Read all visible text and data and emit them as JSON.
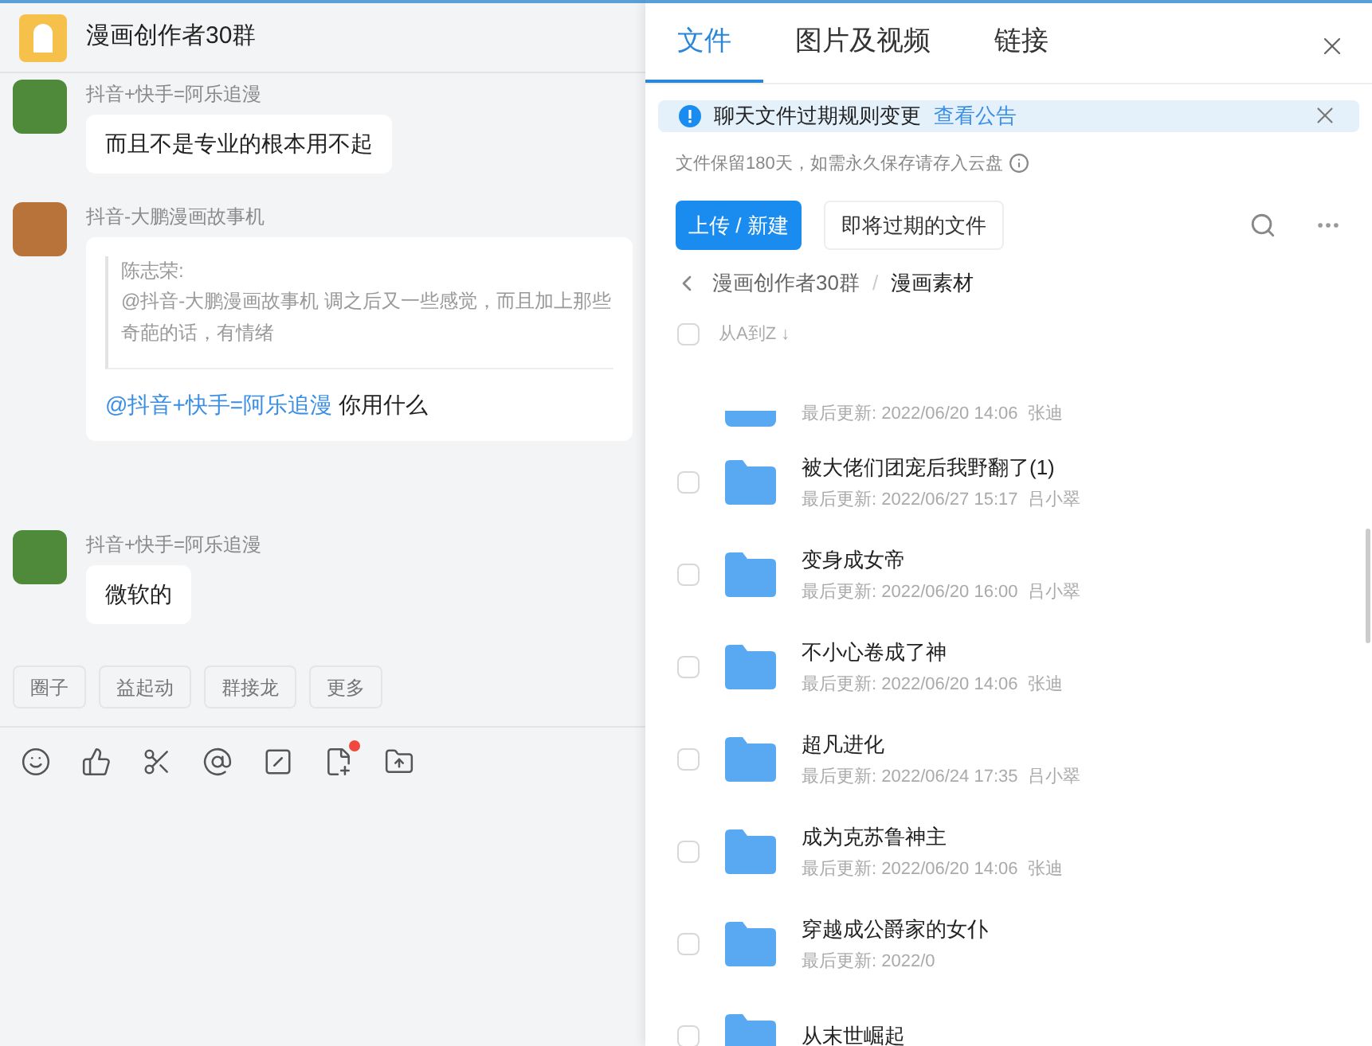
{
  "chat": {
    "title": "漫画创作者30群",
    "messages": [
      {
        "kind": "text",
        "sender": "抖音+快手=阿乐追漫",
        "color": "#4e8a3a",
        "text": "而且不是专业的根本用不起"
      },
      {
        "kind": "quote",
        "sender": "抖音-大鹏漫画故事机",
        "color": "#b8733a",
        "quote_author": "陈志荣:",
        "quote_text": "@抖音-大鹏漫画故事机 调之后又一些感觉，而且加上那些奇葩的话，有情绪",
        "mention": "@抖音+快手=阿乐追漫",
        "text": "你用什么"
      },
      {
        "kind": "text",
        "sender": "抖音+快手=阿乐追漫",
        "color": "#4e8a3a",
        "text": "微软的"
      }
    ],
    "quick_actions": [
      "圈子",
      "益起动",
      "群接龙",
      "更多"
    ],
    "toolbar": [
      {
        "kind": "emoji",
        "badge": false
      },
      {
        "kind": "like",
        "badge": false
      },
      {
        "kind": "scissors",
        "badge": false
      },
      {
        "kind": "at",
        "badge": false
      },
      {
        "kind": "slash",
        "badge": false
      },
      {
        "kind": "note",
        "badge": true
      },
      {
        "kind": "upload",
        "badge": false
      }
    ]
  },
  "files_panel": {
    "tabs": [
      {
        "label": "文件",
        "selected": true
      },
      {
        "label": "图片及视频",
        "selected": false
      },
      {
        "label": "链接",
        "selected": false
      }
    ],
    "notice": {
      "text": "聊天文件过期规则变更",
      "link": "查看公告"
    },
    "retention_note": "文件保留180天，如需永久保存请存入云盘",
    "upload_button": "上传 / 新建",
    "expiring_button": "即将过期的文件",
    "breadcrumb": [
      "漫画创作者30群",
      "漫画素材"
    ],
    "breadcrumb_separator": "/",
    "sort": {
      "label": "从A到Z",
      "arrow": "↓",
      "checked": false
    },
    "files": [
      {
        "meta": "最后更新: 2022/06/20 14:06  张迪"
      },
      {
        "name": "被大佬们团宠后我野翻了(1)",
        "meta": "最后更新: 2022/06/27 15:17  吕小翠",
        "checked": false
      },
      {
        "name": "变身成女帝",
        "meta": "最后更新: 2022/06/20 16:00  吕小翠",
        "checked": false
      },
      {
        "name": "不小心卷成了神",
        "meta": "最后更新: 2022/06/20 14:06  张迪",
        "checked": false
      },
      {
        "name": "超凡进化",
        "meta": "最后更新: 2022/06/24 17:35  吕小翠",
        "checked": false
      },
      {
        "name": "成为克苏鲁神主",
        "meta": "最后更新: 2022/06/20 14:06  张迪",
        "checked": false
      },
      {
        "name": "穿越成公爵家的女仆",
        "meta": "最后更新: 2022/0",
        "checked": false
      },
      {
        "name": "从末世崛起",
        "checked": false
      }
    ]
  }
}
